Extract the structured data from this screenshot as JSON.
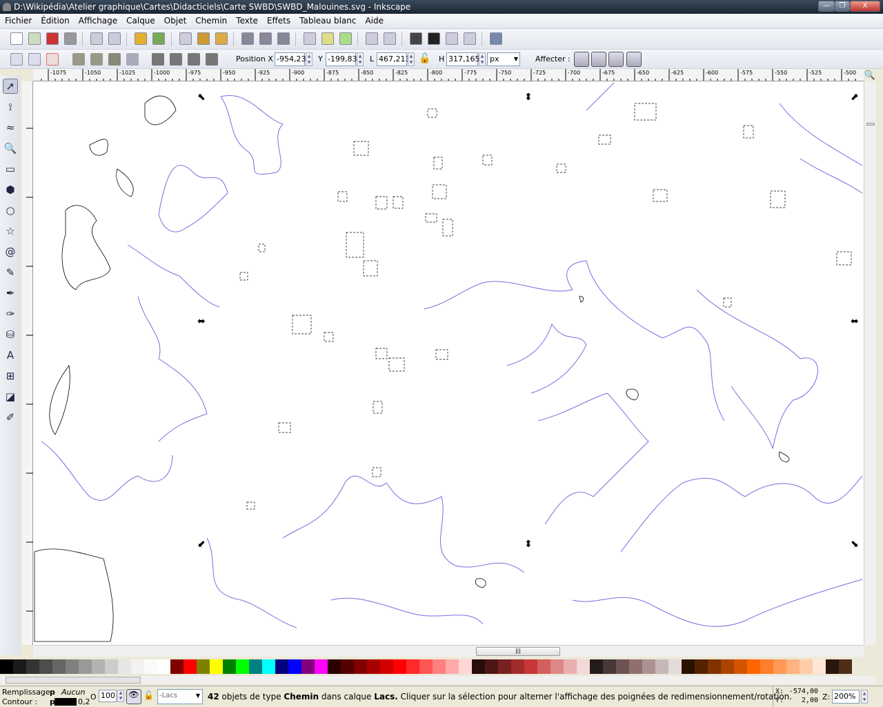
{
  "window": {
    "title": "D:\\Wikipédia\\Atelier graphique\\Cartes\\Didacticiels\\Carte SWBD\\SWBD_Malouines.svg - Inkscape",
    "minimize": "—",
    "restore": "❐",
    "close": "X"
  },
  "menu": [
    "Fichier",
    "Édition",
    "Affichage",
    "Calque",
    "Objet",
    "Chemin",
    "Texte",
    "Effets",
    "Tableau blanc",
    "Aide"
  ],
  "toolbar_commands": [
    "new-icon",
    "open-icon",
    "save-icon",
    "print-icon",
    "import-icon",
    "export-icon",
    "undo-icon",
    "redo-icon",
    "duplicate-icon",
    "cut-icon",
    "paste-icon",
    "zoom-selection-icon",
    "zoom-drawing-icon",
    "zoom-page-icon",
    "clone-icon",
    "group-icon",
    "ungroup-icon",
    "node-editor-icon",
    "xml-editor-icon",
    "text-icon",
    "fill-stroke-icon",
    "align-icon",
    "preferences-icon",
    "document-properties-icon"
  ],
  "selector_bar": {
    "pos_x_label": "Position X",
    "pos_x": "-954,23",
    "y_label": "Y",
    "y": "-199,83",
    "w_label": "L",
    "w": "467,213",
    "h_label": "H",
    "h": "317,165",
    "unit": "px",
    "affect_label": "Affecter :"
  },
  "ruler": {
    "labels": [
      "-1075",
      "-1050",
      "-1025",
      "-1000",
      "-975",
      "-950",
      "-925",
      "-900",
      "-875",
      "-850",
      "-825",
      "-800",
      "-775",
      "-750",
      "-725",
      "-700",
      "-675",
      "-650",
      "-625",
      "-600",
      "-575",
      "-550",
      "-525",
      "-500"
    ]
  },
  "tools": [
    "selector-icon",
    "node-icon",
    "tweak-icon",
    "zoom-icon",
    "rectangle-icon",
    "box-3d-icon",
    "ellipse-icon",
    "star-icon",
    "spiral-icon",
    "pencil-icon",
    "pen-icon",
    "calligraphy-icon",
    "paint-bucket-icon",
    "text-tool-icon",
    "connector-icon",
    "gradient-icon",
    "dropper-icon"
  ],
  "palette": [
    "#000000",
    "#1a1a1a",
    "#333333",
    "#4d4d4d",
    "#666666",
    "#808080",
    "#999999",
    "#b3b3b3",
    "#cccccc",
    "#e6e6e6",
    "#f2f2f2",
    "#fafafa",
    "#ffffff",
    "#800000",
    "#ff0000",
    "#808000",
    "#ffff00",
    "#008000",
    "#00ff00",
    "#008080",
    "#00ffff",
    "#000080",
    "#0000ff",
    "#800080",
    "#ff00ff",
    "#2b0000",
    "#550000",
    "#800000",
    "#aa0000",
    "#d40000",
    "#ff0000",
    "#ff2a2a",
    "#ff5555",
    "#ff8080",
    "#ffaaaa",
    "#ffd5d5",
    "#280b0b",
    "#501616",
    "#782121",
    "#a02c2c",
    "#c83737",
    "#d35f5f",
    "#de8787",
    "#e9afaf",
    "#f4d7d7",
    "#241c1c",
    "#483737",
    "#6c5353",
    "#916f6f",
    "#ac9393",
    "#c8b7b7",
    "#e3dbdb",
    "#2b1100",
    "#552200",
    "#803300",
    "#aa4400",
    "#d45500",
    "#ff6600",
    "#ff7f2a",
    "#ff9955",
    "#ffb380",
    "#ffccaa",
    "#ffe6d5",
    "#28170b",
    "#502d16"
  ],
  "status": {
    "fill_label": "Remplissage :",
    "fill_value": "Aucun",
    "fill_p": "p",
    "stroke_label": "Contour :",
    "stroke_p": "p",
    "stroke_width": "0,2",
    "stroke_color": "#000000",
    "opacity_label": "O :",
    "opacity": "100",
    "layer": "-Lacs",
    "msg_count": "42",
    "msg_1": " objets de type ",
    "msg_type": "Chemin",
    "msg_2": " dans calque ",
    "msg_layer": "Lacs.",
    "msg_3": " Cliquer sur la sélection pour alterner l'affichage des poignées de redimensionnement/rotation.",
    "x_label": "X:",
    "x": "-574,00",
    "y_label": "Y:",
    "y": "2,00",
    "zoom_label": "Z:",
    "zoom": "200%"
  },
  "colors": {
    "coast": "#000000",
    "contour": "#7070e0",
    "selection_dash": "#000000"
  }
}
